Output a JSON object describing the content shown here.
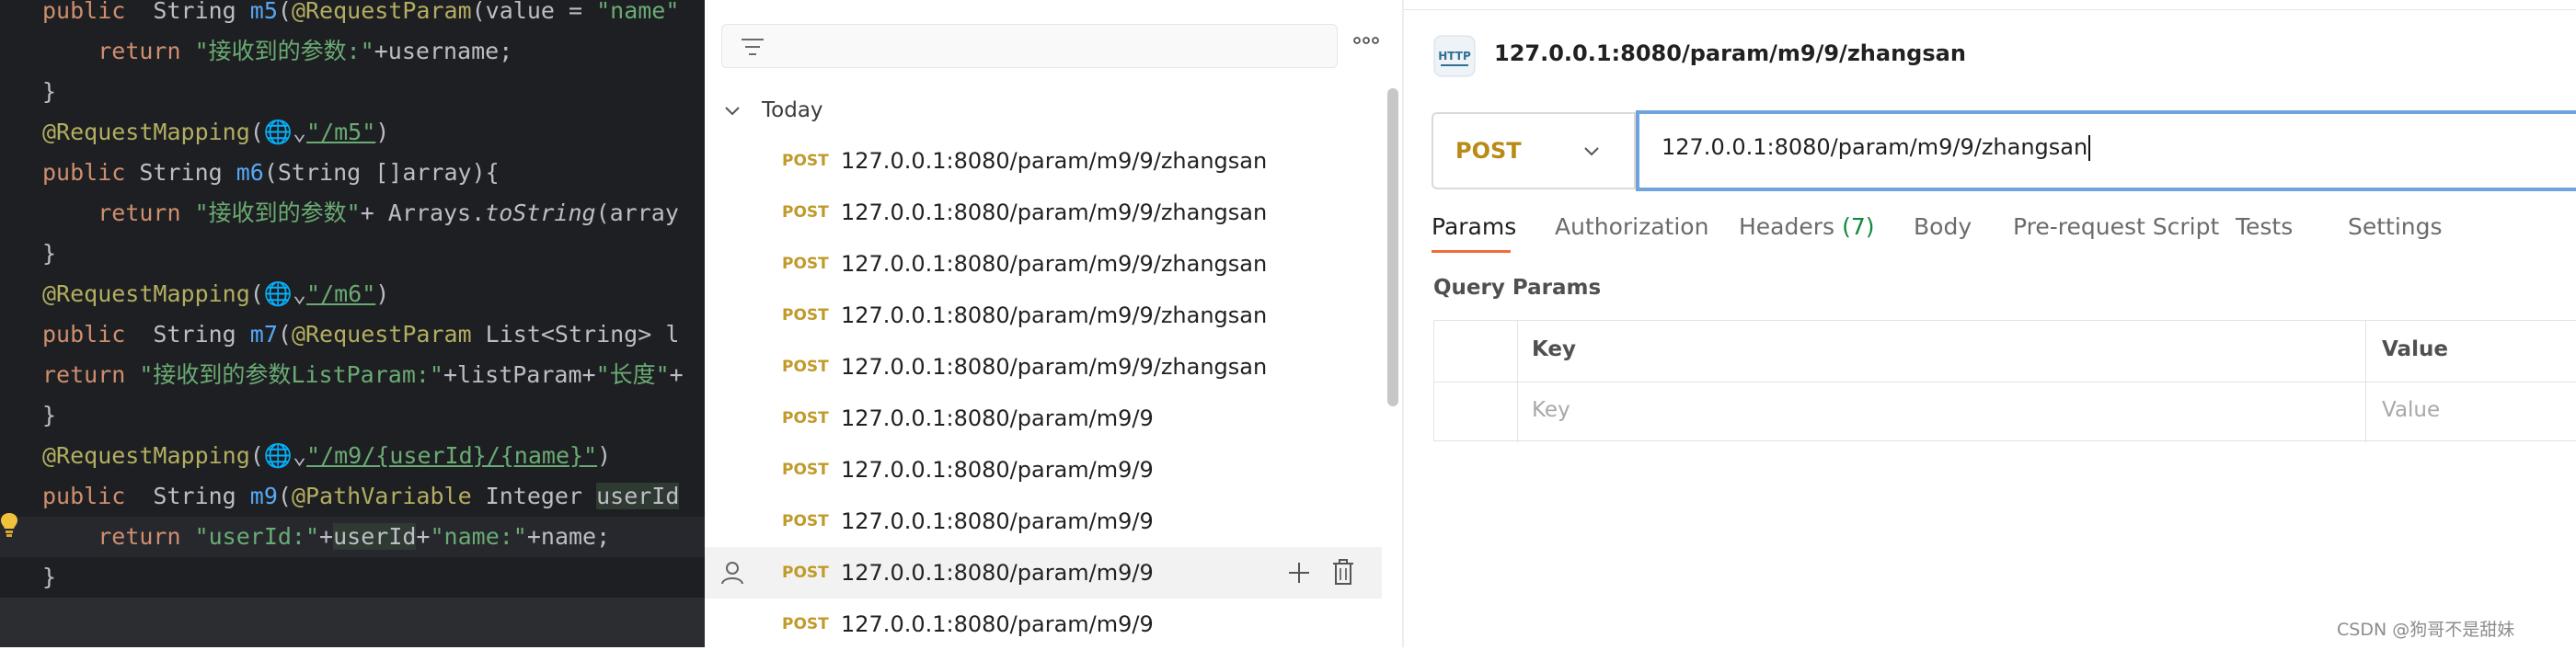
{
  "editor": {
    "lines": [
      {
        "highlight": false,
        "tokens": [
          {
            "t": "public  ",
            "c": "kw"
          },
          {
            "t": "String "
          },
          {
            "t": "m5",
            "c": "fn"
          },
          {
            "t": "("
          },
          {
            "t": "@RequestParam",
            "c": "ann"
          },
          {
            "t": "(value = "
          },
          {
            "t": "\"name\"",
            "c": "str"
          }
        ]
      },
      {
        "highlight": false,
        "tokens": [
          {
            "t": "    "
          },
          {
            "t": "return ",
            "c": "kw"
          },
          {
            "t": "\"接收到的参数:\"",
            "c": "str"
          },
          {
            "t": "+username;"
          }
        ]
      },
      {
        "highlight": false,
        "tokens": [
          {
            "t": "}"
          }
        ]
      },
      {
        "highlight": false,
        "tokens": [
          {
            "t": "@RequestMapping",
            "c": "ann"
          },
          {
            "t": "("
          },
          {
            "t": "🌐⌄",
            "c": "globe"
          },
          {
            "t": "\"/m5\"",
            "c": "str"
          },
          {
            "t": ")"
          }
        ]
      },
      {
        "highlight": false,
        "tokens": [
          {
            "t": "public ",
            "c": "kw"
          },
          {
            "t": "String "
          },
          {
            "t": "m6",
            "c": "fn"
          },
          {
            "t": "(String []array){"
          }
        ]
      },
      {
        "highlight": false,
        "tokens": [
          {
            "t": "    "
          },
          {
            "t": "return ",
            "c": "kw"
          },
          {
            "t": "\"接收到的参数\"",
            "c": "str"
          },
          {
            "t": "+ Arrays."
          },
          {
            "t": "toString",
            "c": "it"
          },
          {
            "t": "(array"
          }
        ]
      },
      {
        "highlight": false,
        "tokens": [
          {
            "t": "}"
          }
        ]
      },
      {
        "highlight": false,
        "tokens": [
          {
            "t": "@RequestMapping",
            "c": "ann"
          },
          {
            "t": "("
          },
          {
            "t": "🌐⌄",
            "c": "globe"
          },
          {
            "t": "\"/m6\"",
            "c": "str"
          },
          {
            "t": ")"
          }
        ]
      },
      {
        "highlight": false,
        "tokens": [
          {
            "t": "public  ",
            "c": "kw"
          },
          {
            "t": "String "
          },
          {
            "t": "m7",
            "c": "fn"
          },
          {
            "t": "("
          },
          {
            "t": "@RequestParam ",
            "c": "ann"
          },
          {
            "t": "List<String> l"
          }
        ]
      },
      {
        "highlight": false,
        "tokens": [
          {
            "t": "return ",
            "c": "kw"
          },
          {
            "t": "\"接收到的参数ListParam:\"",
            "c": "str"
          },
          {
            "t": "+listParam+"
          },
          {
            "t": "\"长度\"",
            "c": "str"
          },
          {
            "t": "+"
          }
        ]
      },
      {
        "highlight": false,
        "tokens": [
          {
            "t": "}"
          }
        ]
      },
      {
        "highlight": false,
        "tokens": [
          {
            "t": "@RequestMapping",
            "c": "ann"
          },
          {
            "t": "("
          },
          {
            "t": "🌐⌄",
            "c": "globe"
          },
          {
            "t": "\"/m9/{userId}/{name}\"",
            "c": "str"
          },
          {
            "t": ")"
          }
        ]
      },
      {
        "highlight": false,
        "tokens": [
          {
            "t": "public  ",
            "c": "kw"
          },
          {
            "t": "String "
          },
          {
            "t": "m9",
            "c": "fn"
          },
          {
            "t": "("
          },
          {
            "t": "@PathVariable ",
            "c": "ann"
          },
          {
            "t": "Integer "
          },
          {
            "t": "userId",
            "c": "var"
          }
        ]
      },
      {
        "highlight": true,
        "tokens": [
          {
            "t": "    "
          },
          {
            "t": "return ",
            "c": "kw"
          },
          {
            "t": "\"userId:\"",
            "c": "str"
          },
          {
            "t": "+"
          },
          {
            "t": "userId",
            "c": "var"
          },
          {
            "t": "+"
          },
          {
            "t": "\"name:\"",
            "c": "str"
          },
          {
            "t": "+name;"
          }
        ]
      },
      {
        "highlight": false,
        "tokens": [
          {
            "t": "}"
          }
        ]
      }
    ]
  },
  "history": {
    "group_label": "Today",
    "items": [
      {
        "method": "POST",
        "url": "127.0.0.1:8080/param/m9/9/zhangsan"
      },
      {
        "method": "POST",
        "url": "127.0.0.1:8080/param/m9/9/zhangsan"
      },
      {
        "method": "POST",
        "url": "127.0.0.1:8080/param/m9/9/zhangsan"
      },
      {
        "method": "POST",
        "url": "127.0.0.1:8080/param/m9/9/zhangsan"
      },
      {
        "method": "POST",
        "url": "127.0.0.1:8080/param/m9/9/zhangsan"
      },
      {
        "method": "POST",
        "url": "127.0.0.1:8080/param/m9/9"
      },
      {
        "method": "POST",
        "url": "127.0.0.1:8080/param/m9/9"
      },
      {
        "method": "POST",
        "url": "127.0.0.1:8080/param/m9/9"
      },
      {
        "method": "POST",
        "url": "127.0.0.1:8080/param/m9/9"
      },
      {
        "method": "POST",
        "url": "127.0.0.1:8080/param/m9/9"
      }
    ]
  },
  "request": {
    "icon_label": "HTTP",
    "title": "127.0.0.1:8080/param/m9/9/zhangsan",
    "method": "POST",
    "url": "127.0.0.1:8080/param/m9/9/zhangsan",
    "tabs": [
      {
        "label": "Params",
        "count": ""
      },
      {
        "label": "Authorization",
        "count": ""
      },
      {
        "label": "Headers",
        "count": "(7)"
      },
      {
        "label": "Body",
        "count": ""
      },
      {
        "label": "Pre-request Script",
        "count": ""
      },
      {
        "label": "Tests",
        "count": ""
      },
      {
        "label": "Settings",
        "count": ""
      }
    ],
    "query_params": {
      "title": "Query Params",
      "key_header": "Key",
      "value_header": "Value",
      "key_placeholder": "Key",
      "value_placeholder": "Value"
    }
  },
  "watermark": "CSDN @狗哥不是甜妹",
  "colors": {
    "method_post": "#c09a2a",
    "accent": "#f26b3a",
    "url_focus": "#6ea3dd",
    "editor_bg": "#1e1f22"
  }
}
